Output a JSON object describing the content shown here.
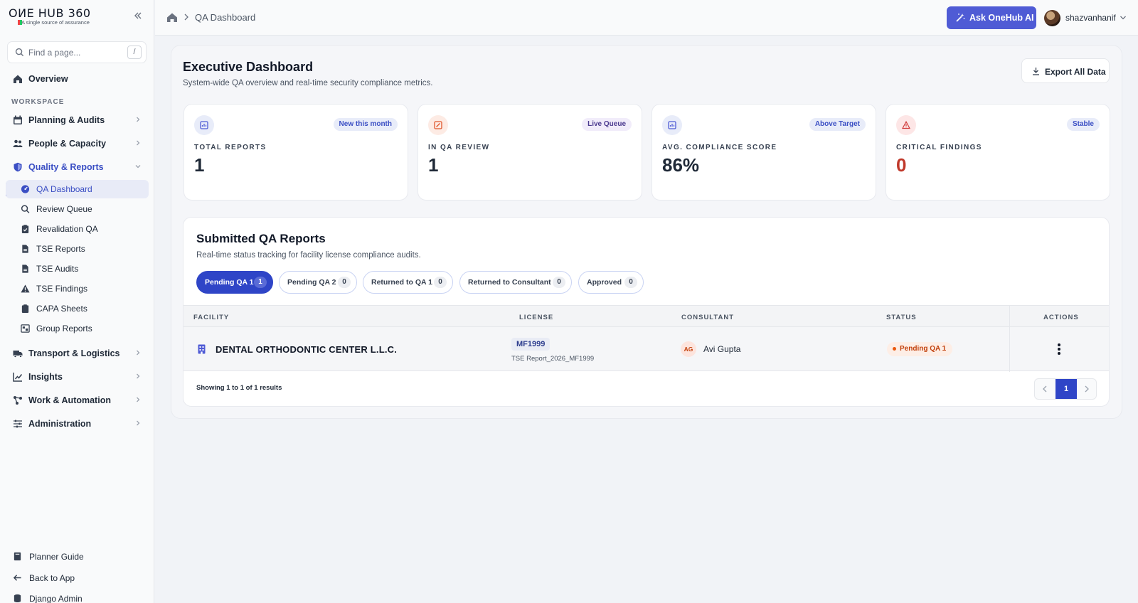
{
  "brand": {
    "name": "OИE HUB 360",
    "tagline": "A single source of assurance"
  },
  "search": {
    "placeholder": "Find a page...",
    "shortcut": "/"
  },
  "sidebar": {
    "overview": "Overview",
    "section": "WORKSPACE",
    "groups": [
      {
        "label": "Planning & Audits",
        "icon": "calendar-icon"
      },
      {
        "label": "People & Capacity",
        "icon": "people-icon"
      },
      {
        "label": "Quality & Reports",
        "icon": "shield-icon"
      },
      {
        "label": "Transport & Logistics",
        "icon": "truck-icon"
      },
      {
        "label": "Insights",
        "icon": "chart-icon"
      },
      {
        "label": "Work & Automation",
        "icon": "workflow-icon"
      },
      {
        "label": "Administration",
        "icon": "sliders-icon"
      }
    ],
    "sub_items": [
      {
        "label": "QA Dashboard",
        "icon": "dashboard-icon"
      },
      {
        "label": "Review Queue",
        "icon": "search-icon"
      },
      {
        "label": "Revalidation QA",
        "icon": "clipboard-check-icon"
      },
      {
        "label": "TSE Reports",
        "icon": "document-icon"
      },
      {
        "label": "TSE Audits",
        "icon": "document-icon"
      },
      {
        "label": "TSE Findings",
        "icon": "warning-icon"
      },
      {
        "label": "CAPA Sheets",
        "icon": "clipboard-icon"
      },
      {
        "label": "Group Reports",
        "icon": "group-report-icon"
      }
    ],
    "footer": [
      {
        "label": "Planner Guide",
        "icon": "book-icon"
      },
      {
        "label": "Back to App",
        "icon": "arrow-left-icon"
      },
      {
        "label": "Django Admin",
        "icon": "database-icon"
      }
    ]
  },
  "topbar": {
    "breadcrumb": "QA Dashboard",
    "ai_button": "Ask OneHub AI",
    "username": "shazvanhanif"
  },
  "header": {
    "title": "Executive Dashboard",
    "subtitle": "System-wide QA overview and real-time security compliance metrics.",
    "export_label": "Export All Data"
  },
  "stats": [
    {
      "label": "TOTAL REPORTS",
      "value": "1",
      "badge": "New this month",
      "icon": "report-icon"
    },
    {
      "label": "IN QA REVIEW",
      "value": "1",
      "badge": "Live Queue",
      "icon": "review-icon"
    },
    {
      "label": "AVG. COMPLIANCE SCORE",
      "value": "86%",
      "badge": "Above Target",
      "icon": "score-icon"
    },
    {
      "label": "CRITICAL FINDINGS",
      "value": "0",
      "badge": "Stable",
      "icon": "alert-icon"
    }
  ],
  "reports": {
    "title": "Submitted QA Reports",
    "subtitle": "Real-time status tracking for facility license compliance audits.",
    "tabs": [
      {
        "label": "Pending QA 1",
        "count": "1"
      },
      {
        "label": "Pending QA 2",
        "count": "0"
      },
      {
        "label": "Returned to QA 1",
        "count": "0"
      },
      {
        "label": "Returned to Consultant",
        "count": "0"
      },
      {
        "label": "Approved",
        "count": "0"
      }
    ],
    "columns": [
      "FACILITY",
      "LICENSE",
      "CONSULTANT",
      "STATUS",
      "ACTIONS"
    ],
    "rows": [
      {
        "facility": "DENTAL ORTHODONTIC CENTER L.L.C.",
        "license": "MF1999",
        "report": "TSE Report_2026_MF1999",
        "consultant_initials": "AG",
        "consultant": "Avi Gupta",
        "status": "Pending QA 1"
      }
    ],
    "showing": "Showing 1 to 1 of 1 results",
    "page": "1"
  },
  "colors": {
    "accent": "#2f45c7",
    "ai_button": "#4f5bd5",
    "critical": "#c0392b",
    "pending": "#c2410c"
  }
}
